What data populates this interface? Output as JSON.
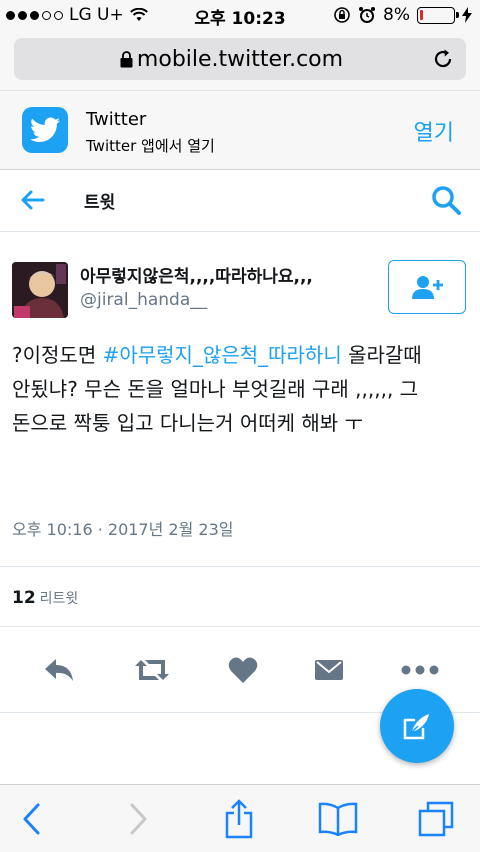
{
  "status_bar": {
    "carrier": "LG U+",
    "time": "오후 10:23",
    "battery_percent": "8%",
    "battery_level": 0.08,
    "battery_color": "#e0252b"
  },
  "url_bar": {
    "url": "mobile.twitter.com",
    "lock_icon": "lock-icon",
    "reload_icon": "reload-icon"
  },
  "app_banner": {
    "app_name": "Twitter",
    "subtitle": "Twitter 앱에서 열기",
    "open_label": "열기"
  },
  "header": {
    "title": "트윗",
    "back_icon": "back-arrow-icon",
    "search_icon": "search-icon"
  },
  "tweet": {
    "display_name": "아무렇지않은척,,,,따라하나요,,,",
    "handle": "@jiral_handa__",
    "text_before": "?이정도면 ",
    "hashtag": "#아무렇지_않은척_따라하니",
    "text_after": " 올라갈때 안됬냐? 무슨 돈을 얼마나 부엇길래 구래 ,,,,,, 그 돈으로 짝퉁 입고 다니는거 어떠케 해봐 ㅜ",
    "timestamp": "오후 10:16 · 2017년 2월 23일",
    "retweet_count": "12",
    "retweet_label": "리트윗"
  },
  "actions": [
    "reply-icon",
    "retweet-icon",
    "like-icon",
    "direct-message-icon",
    "more-icon"
  ],
  "fab": {
    "icon": "compose-icon"
  },
  "toolbar": [
    "back-icon",
    "forward-icon",
    "share-icon",
    "bookmarks-icon",
    "tabs-icon"
  ],
  "colors": {
    "accent": "#1da1f2",
    "text": "#14171a",
    "secondary": "#657786",
    "action_icons": "#657786"
  }
}
